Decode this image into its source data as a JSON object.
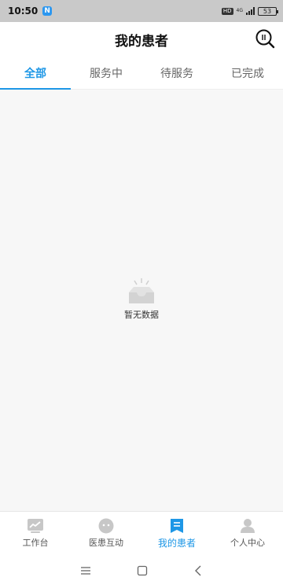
{
  "status_bar": {
    "time": "10:50",
    "app_badge": "N",
    "hd": "HD",
    "network_top": "4G",
    "battery": "53"
  },
  "header": {
    "title": "我的患者",
    "search_icon": "search-icon"
  },
  "tabs": [
    {
      "label": "全部",
      "active": true
    },
    {
      "label": "服务中",
      "active": false
    },
    {
      "label": "待服务",
      "active": false
    },
    {
      "label": "已完成",
      "active": false
    }
  ],
  "empty_state": {
    "icon": "empty-tray-icon",
    "text": "暂无数据"
  },
  "bottom_nav": [
    {
      "label": "工作台",
      "icon": "chart-icon",
      "active": false
    },
    {
      "label": "医患互动",
      "icon": "chat-bubble-icon",
      "active": false
    },
    {
      "label": "我的患者",
      "icon": "bookmark-list-icon",
      "active": true
    },
    {
      "label": "个人中心",
      "icon": "person-icon",
      "active": false
    }
  ],
  "system_nav": [
    "menu-icon",
    "home-icon",
    "back-icon"
  ],
  "colors": {
    "accent": "#1e97e6",
    "background": "#f7f7f7",
    "inactive_icon": "#c7c7c7"
  }
}
